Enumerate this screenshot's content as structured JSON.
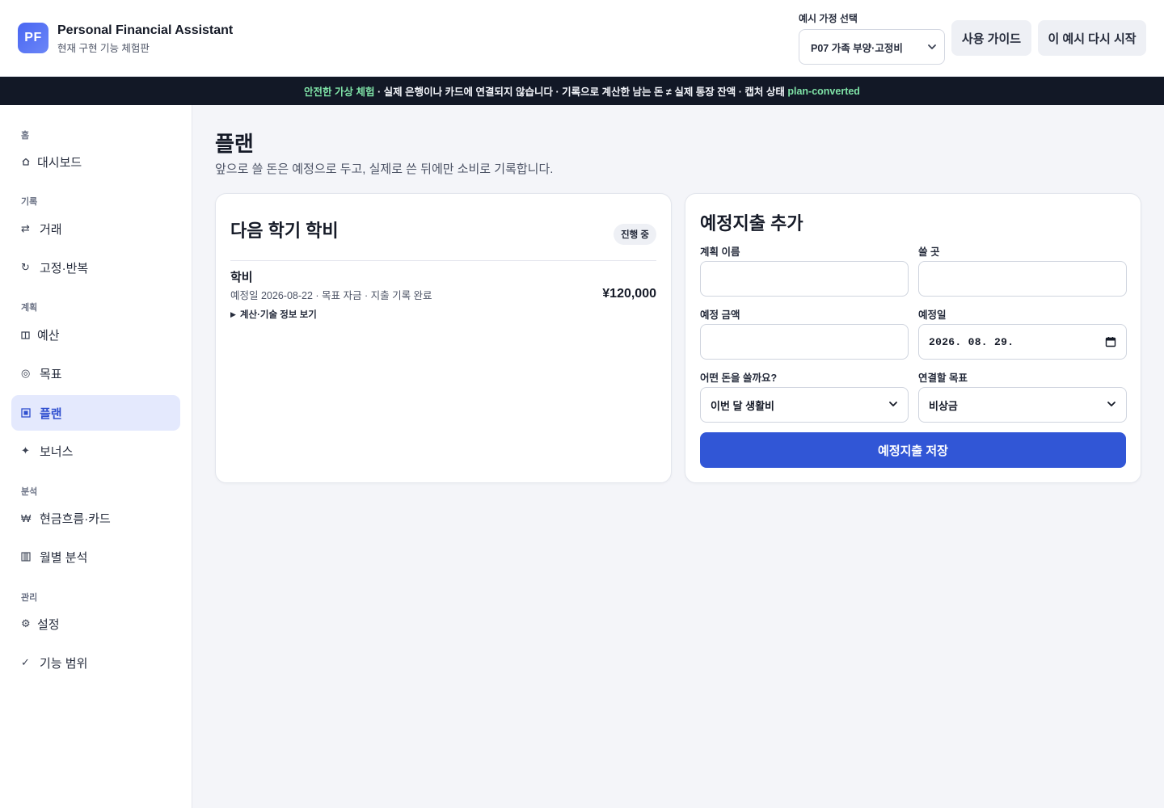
{
  "header": {
    "logo_text": "PF",
    "title": "Personal Financial Assistant",
    "subtitle": "현재 구현 기능 체험판",
    "household_label": "예시 가정 선택",
    "household_selected": "P07 가족 부양·고정비",
    "guide_button": "사용 가이드",
    "restart_button": "이 예시 다시 시작"
  },
  "banner": {
    "highlight": "안전한 가상 체험",
    "text": " · 실제 은행이나 카드에 연결되지 않습니다 · 기록으로 계산한 남는 돈 ≠ 실제 통장 잔액 · 캡처 상태 ",
    "state": "plan-converted"
  },
  "sidebar": {
    "sections": [
      {
        "label": "홈",
        "items": [
          {
            "label": "대시보드",
            "icon": "home-icon"
          }
        ]
      },
      {
        "label": "기록",
        "items": [
          {
            "label": "거래",
            "icon": "swap-icon"
          },
          {
            "label": "고정·반복",
            "icon": "repeat-icon"
          }
        ]
      },
      {
        "label": "계획",
        "items": [
          {
            "label": "예산",
            "icon": "budget-icon"
          },
          {
            "label": "목표",
            "icon": "target-icon"
          },
          {
            "label": "플랜",
            "icon": "plan-icon",
            "active": true
          },
          {
            "label": "보너스",
            "icon": "sparkle-icon"
          }
        ]
      },
      {
        "label": "분석",
        "items": [
          {
            "label": "현금흐름·카드",
            "icon": "won-icon"
          },
          {
            "label": "월별 분석",
            "icon": "bars-icon"
          }
        ]
      },
      {
        "label": "관리",
        "items": [
          {
            "label": "설정",
            "icon": "gear-icon"
          },
          {
            "label": "기능 범위",
            "icon": "check-icon"
          }
        ]
      }
    ]
  },
  "page": {
    "title": "플랜",
    "description": "앞으로 쓸 돈은 예정으로 두고, 실제로 쓴 뒤에만 소비로 기록합니다."
  },
  "plan_card": {
    "title": "다음 학기 학비",
    "status": "진행 중",
    "item": {
      "name": "학비",
      "meta": "예정일 2026-08-22 · 목표 자금 · 지출 기록 완료",
      "amount": "¥120,000"
    },
    "details_toggle": "계산·기술 정보 보기"
  },
  "form": {
    "title": "예정지출 추가",
    "plan_name_label": "계획 이름",
    "plan_name_value": "",
    "place_label": "쓸 곳",
    "place_value": "",
    "amount_label": "예정 금액",
    "amount_value": "",
    "date_label": "예정일",
    "date_value": "2026. 08. 29.",
    "money_source_label": "어떤 돈을 쓸까요?",
    "money_source_value": "이번 달 생활비",
    "goal_label": "연결할 목표",
    "goal_value": "비상금",
    "save_button": "예정지출 저장"
  },
  "colors": {
    "accent": "#3156d6",
    "active_nav_bg": "#e4e9fd",
    "banner_bg": "#121826",
    "banner_highlight": "#7fe3a7"
  }
}
